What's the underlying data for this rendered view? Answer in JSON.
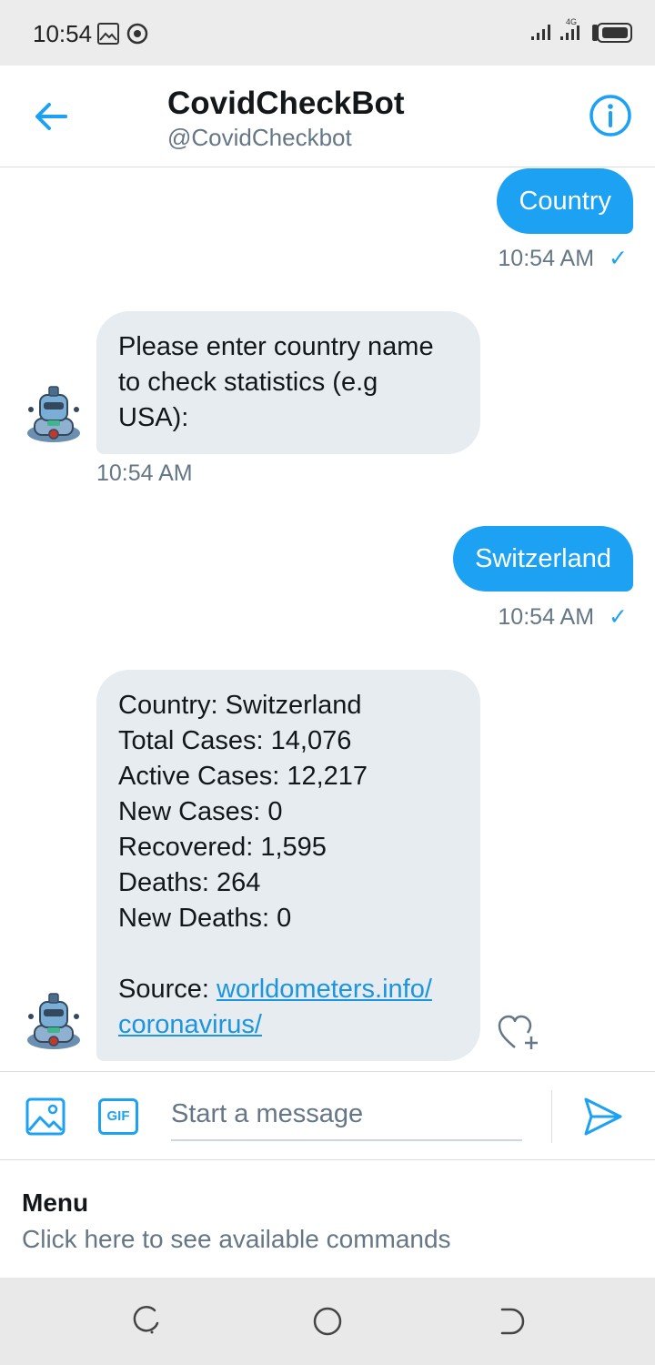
{
  "status_bar": {
    "time": "10:54",
    "network": "4G"
  },
  "header": {
    "title": "CovidCheckBot",
    "handle": "@CovidCheckbot"
  },
  "messages": [
    {
      "direction": "out",
      "text": "Country",
      "time": "10:54 AM",
      "read_mark": "✓"
    },
    {
      "direction": "in",
      "lines": [
        "Please enter country name",
        "to check statistics (e.g",
        "USA):"
      ],
      "time": "10:54 AM"
    },
    {
      "direction": "out",
      "text": "Switzerland",
      "time": "10:54 AM",
      "read_mark": "✓"
    },
    {
      "direction": "in",
      "lines": [
        "Country: Switzerland",
        "Total Cases: 14,076",
        "Active Cases: 12,217",
        "New Cases: 0",
        "Recovered: 1,595",
        "Deaths: 264",
        "New Deaths: 0"
      ],
      "source_label": "Source: ",
      "source_link_1": "worldometers.info/",
      "source_link_2": "coronavirus/"
    }
  ],
  "composer": {
    "placeholder": "Start a message",
    "gif_label": "GIF"
  },
  "menu": {
    "title": "Menu",
    "subtitle": "Click here to see available commands"
  },
  "colors": {
    "accent": "#1da1f2",
    "bubble_in": "#e6ecf0",
    "secondary_text": "#657786"
  }
}
